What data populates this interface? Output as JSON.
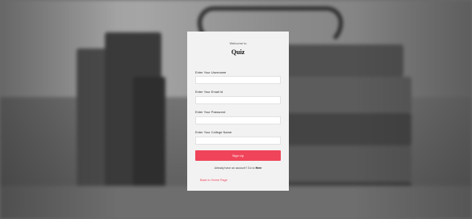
{
  "form": {
    "welcome": "Welcome to",
    "title": "Quiz",
    "fields": [
      {
        "label": "Enter Your Username",
        "value": ""
      },
      {
        "label": "Enter Your Email Id",
        "value": ""
      },
      {
        "label": "Enter Your Password",
        "value": ""
      },
      {
        "label": "Enter Your College Name",
        "value": ""
      }
    ],
    "signup_label": "Sign Up",
    "already_text": "Already have an account? Go to",
    "login_link": "Here",
    "back_link": "Back to Home Page"
  },
  "colors": {
    "accent": "#f0445a",
    "card_background": "#f2f2f2"
  }
}
